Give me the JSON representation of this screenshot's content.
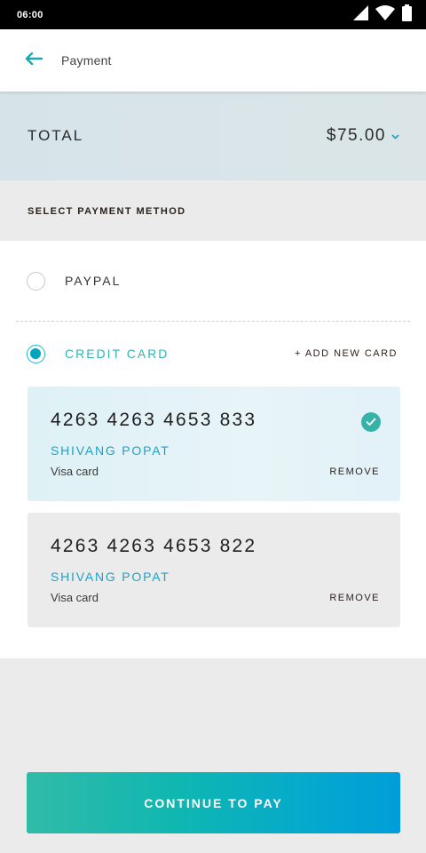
{
  "status_bar": {
    "time": "06:00"
  },
  "app_bar": {
    "title": "Payment"
  },
  "total": {
    "label": "TOTAL",
    "amount": "$75.00"
  },
  "section": {
    "heading": "SELECT PAYMENT METHOD"
  },
  "methods": {
    "paypal_label": "PAYPAL",
    "credit_card_label": "CREDIT CARD",
    "add_card_label": "+ ADD NEW CARD"
  },
  "cards": [
    {
      "number": "4263 4263 4653 833",
      "holder": "SHIVANG POPAT",
      "type": "Visa card",
      "remove_label": "REMOVE",
      "selected": true
    },
    {
      "number": "4263 4263 4653 822",
      "holder": "SHIVANG POPAT",
      "type": "Visa card",
      "remove_label": "REMOVE",
      "selected": false
    }
  ],
  "actions": {
    "pay_label": "CONTINUE TO PAY"
  },
  "colors": {
    "accent": "#00a6bd",
    "holder_text": "#1ea2c8",
    "check": "#36b3a9"
  }
}
